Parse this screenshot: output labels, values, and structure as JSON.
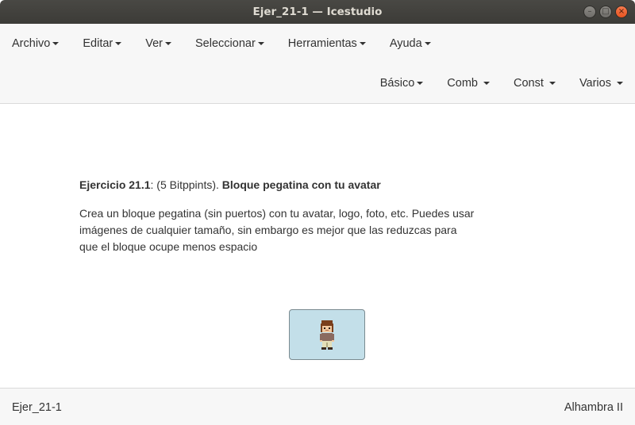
{
  "window": {
    "title": "Ejer_21-1 — Icestudio",
    "controls": [
      "minimize-icon",
      "maximize-icon",
      "close-icon"
    ]
  },
  "menubar": {
    "items": [
      {
        "label": "Archivo"
      },
      {
        "label": "Editar"
      },
      {
        "label": "Ver"
      },
      {
        "label": "Seleccionar"
      },
      {
        "label": "Herramientas"
      },
      {
        "label": "Ayuda"
      }
    ]
  },
  "blocks_menu": {
    "items": [
      {
        "label": "Básico"
      },
      {
        "label": "Comb"
      },
      {
        "label": "Const"
      },
      {
        "label": "Varios"
      }
    ]
  },
  "info": {
    "exercise_label": "Ejercicio 21.1",
    "points": ": (5 Bitppints). ",
    "block_title": "Bloque pegatina con tu avatar",
    "description": "Crea un bloque pegatina (sin puertos) con tu avatar, logo, foto, etc. Puedes usar imágenes de cualquier tamaño, sin embargo es mejor que las reduzcas para que el bloque ocupe menos espacio"
  },
  "sticker": {
    "image": "avatar-icon",
    "background": "#c3dfe9"
  },
  "statusbar": {
    "filename": "Ejer_21-1",
    "board": "Alhambra II"
  },
  "colors": {
    "titlebar": "#3c3b37",
    "close_button": "#e95420",
    "toolbar_bg": "#f7f7f7"
  }
}
